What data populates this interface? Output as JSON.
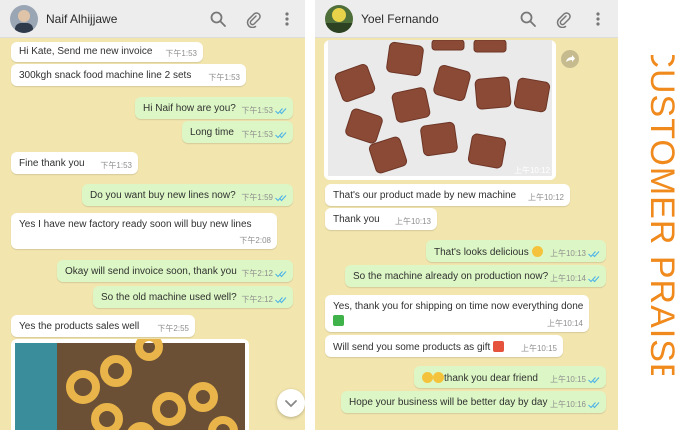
{
  "left_chat": {
    "contact_name": "Naif Alhijjawe",
    "messages": [
      {
        "dir": "in",
        "text": "Hi Kate, Send me new invoice",
        "time": "下午1:53"
      },
      {
        "dir": "in",
        "text": "300kgh snack food machine line 2 sets",
        "time": "下午1:53"
      },
      {
        "dir": "out",
        "text": "Hi Naif how are you?",
        "time": "下午1:53"
      },
      {
        "dir": "out",
        "text": "Long time",
        "time": "下午1:53"
      },
      {
        "dir": "in",
        "text": "Fine thank you",
        "time": "下午1:53"
      },
      {
        "dir": "out",
        "text": "Do you want buy new lines now?",
        "time": "下午1:59"
      },
      {
        "dir": "in",
        "text": "Yes I have new factory ready soon will buy new lines",
        "time": "下午2:08"
      },
      {
        "dir": "out",
        "text": "Okay will send invoice soon, thank you",
        "time": "下午2:12"
      },
      {
        "dir": "out",
        "text": "So the old machine used well?",
        "time": "下午2:12"
      },
      {
        "dir": "in",
        "text": "Yes the products sales well",
        "time": "下午2:55"
      }
    ]
  },
  "right_chat": {
    "contact_name": "Yoel Fernando",
    "photo_time": "上午10:12",
    "messages": [
      {
        "dir": "in",
        "text": "That's our product made by new machine",
        "time": "上午10:12"
      },
      {
        "dir": "in",
        "text": "Thank you",
        "time": "上午10:13"
      },
      {
        "dir": "out",
        "text": "That's looks delicious",
        "time": "上午10:13"
      },
      {
        "dir": "out",
        "text": "So the machine already on production now?",
        "time": "上午10:14"
      },
      {
        "dir": "in",
        "text": "Yes, thank you for shipping on time now everything done",
        "time": "上午10:14"
      },
      {
        "dir": "in",
        "text": "Will send you some products as gift",
        "time": "上午10:15"
      },
      {
        "dir": "out",
        "text": "thank you dear friend",
        "time": "上午10:15"
      },
      {
        "dir": "out",
        "text": "Hope your business will be better day by day",
        "time": "上午10:16"
      }
    ]
  },
  "side_caption": "CUSTOMER PRAISE",
  "colors": {
    "chat_background": "#f2e5ae",
    "outgoing_bubble": "#dcf7c5",
    "incoming_bubble": "#ffffff",
    "read_ticks": "#4fb3e8",
    "caption": "#f08a1c"
  },
  "icons": {
    "header": [
      "search-icon",
      "paperclip-icon",
      "more-vertical-icon"
    ],
    "scroll": "chevron-down-icon",
    "share": "share-icon"
  }
}
